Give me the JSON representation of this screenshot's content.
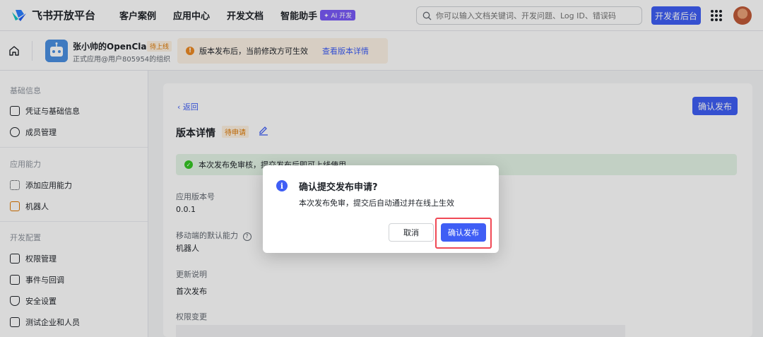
{
  "topnav": {
    "logo_text": "飞书开放平台",
    "links": [
      "客户案例",
      "应用中心",
      "开发文档",
      "智能助手"
    ],
    "ai_badge": "✦ AI 开发",
    "search_placeholder": "你可以输入文档关键词、开发问题、Log ID、错误码",
    "dev_button": "开发者后台"
  },
  "app": {
    "name": "张小帅的OpenClaw",
    "status": "待上线",
    "subtitle": "正式应用@用户805954的组织",
    "notice_text": "版本发布后，当前修改方可生效",
    "notice_link": "查看版本详情"
  },
  "sidebar": {
    "groups": [
      {
        "title": "基础信息",
        "items": [
          "凭证与基础信息",
          "成员管理"
        ]
      },
      {
        "title": "应用能力",
        "items": [
          "添加应用能力",
          "机器人"
        ]
      },
      {
        "title": "开发配置",
        "items": [
          "权限管理",
          "事件与回调",
          "安全设置",
          "测试企业和人员"
        ]
      }
    ]
  },
  "main": {
    "back": "返回",
    "confirm_button": "确认发布",
    "title": "版本详情",
    "title_badge": "待申请",
    "success_text": "本次发布免审核，提交发布后即可上线使用",
    "fields": [
      {
        "label": "应用版本号",
        "value": "0.0.1"
      },
      {
        "label": "移动端的默认能力",
        "value": "机器人"
      },
      {
        "label": "更新说明",
        "value": "首次发布"
      },
      {
        "label": "权限变更",
        "value": ""
      }
    ]
  },
  "dialog": {
    "title": "确认提交发布申请?",
    "body": "本次发布免审，提交后自动通过并在线上生效",
    "cancel": "取消",
    "confirm": "确认发布"
  },
  "colors": {
    "primary": "#3f5ef5",
    "warning": "#de7802",
    "success": "#34c724",
    "highlight": "#f04955"
  }
}
